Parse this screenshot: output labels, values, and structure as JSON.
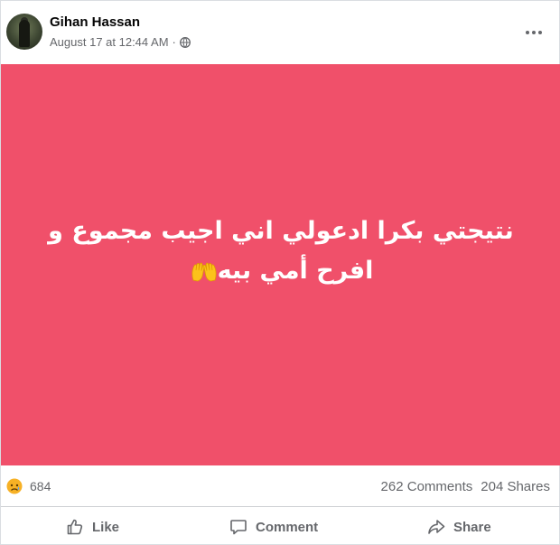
{
  "post": {
    "author": "Gihan Hassan",
    "timestamp": "August 17 at 12:44 AM",
    "separator": "·",
    "privacy_icon": "globe-icon",
    "more_icon": "ellipsis-icon",
    "line1": "نتيجتي بكرا ادعولي اني اجيب مجموع و",
    "line2": "افرح أمي بيه",
    "emoji": "raising-hands-emoji",
    "background_color": "#f0506a"
  },
  "stats": {
    "reaction_icon": "sad-face-icon",
    "reaction_count": "684",
    "comments": "262 Comments",
    "shares": "204 Shares"
  },
  "actions": {
    "like_label": "Like",
    "comment_label": "Comment",
    "share_label": "Share"
  }
}
